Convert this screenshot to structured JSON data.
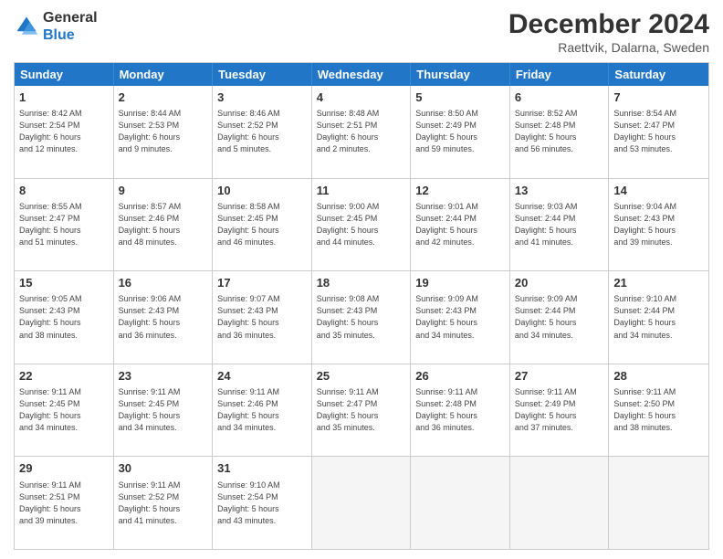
{
  "header": {
    "logo_line1": "General",
    "logo_line2": "Blue",
    "month_title": "December 2024",
    "subtitle": "Raettvik, Dalarna, Sweden"
  },
  "days_of_week": [
    "Sunday",
    "Monday",
    "Tuesday",
    "Wednesday",
    "Thursday",
    "Friday",
    "Saturday"
  ],
  "weeks": [
    [
      {
        "day": "1",
        "lines": [
          "Sunrise: 8:42 AM",
          "Sunset: 2:54 PM",
          "Daylight: 6 hours",
          "and 12 minutes."
        ]
      },
      {
        "day": "2",
        "lines": [
          "Sunrise: 8:44 AM",
          "Sunset: 2:53 PM",
          "Daylight: 6 hours",
          "and 9 minutes."
        ]
      },
      {
        "day": "3",
        "lines": [
          "Sunrise: 8:46 AM",
          "Sunset: 2:52 PM",
          "Daylight: 6 hours",
          "and 5 minutes."
        ]
      },
      {
        "day": "4",
        "lines": [
          "Sunrise: 8:48 AM",
          "Sunset: 2:51 PM",
          "Daylight: 6 hours",
          "and 2 minutes."
        ]
      },
      {
        "day": "5",
        "lines": [
          "Sunrise: 8:50 AM",
          "Sunset: 2:49 PM",
          "Daylight: 5 hours",
          "and 59 minutes."
        ]
      },
      {
        "day": "6",
        "lines": [
          "Sunrise: 8:52 AM",
          "Sunset: 2:48 PM",
          "Daylight: 5 hours",
          "and 56 minutes."
        ]
      },
      {
        "day": "7",
        "lines": [
          "Sunrise: 8:54 AM",
          "Sunset: 2:47 PM",
          "Daylight: 5 hours",
          "and 53 minutes."
        ]
      }
    ],
    [
      {
        "day": "8",
        "lines": [
          "Sunrise: 8:55 AM",
          "Sunset: 2:47 PM",
          "Daylight: 5 hours",
          "and 51 minutes."
        ]
      },
      {
        "day": "9",
        "lines": [
          "Sunrise: 8:57 AM",
          "Sunset: 2:46 PM",
          "Daylight: 5 hours",
          "and 48 minutes."
        ]
      },
      {
        "day": "10",
        "lines": [
          "Sunrise: 8:58 AM",
          "Sunset: 2:45 PM",
          "Daylight: 5 hours",
          "and 46 minutes."
        ]
      },
      {
        "day": "11",
        "lines": [
          "Sunrise: 9:00 AM",
          "Sunset: 2:45 PM",
          "Daylight: 5 hours",
          "and 44 minutes."
        ]
      },
      {
        "day": "12",
        "lines": [
          "Sunrise: 9:01 AM",
          "Sunset: 2:44 PM",
          "Daylight: 5 hours",
          "and 42 minutes."
        ]
      },
      {
        "day": "13",
        "lines": [
          "Sunrise: 9:03 AM",
          "Sunset: 2:44 PM",
          "Daylight: 5 hours",
          "and 41 minutes."
        ]
      },
      {
        "day": "14",
        "lines": [
          "Sunrise: 9:04 AM",
          "Sunset: 2:43 PM",
          "Daylight: 5 hours",
          "and 39 minutes."
        ]
      }
    ],
    [
      {
        "day": "15",
        "lines": [
          "Sunrise: 9:05 AM",
          "Sunset: 2:43 PM",
          "Daylight: 5 hours",
          "and 38 minutes."
        ]
      },
      {
        "day": "16",
        "lines": [
          "Sunrise: 9:06 AM",
          "Sunset: 2:43 PM",
          "Daylight: 5 hours",
          "and 36 minutes."
        ]
      },
      {
        "day": "17",
        "lines": [
          "Sunrise: 9:07 AM",
          "Sunset: 2:43 PM",
          "Daylight: 5 hours",
          "and 36 minutes."
        ]
      },
      {
        "day": "18",
        "lines": [
          "Sunrise: 9:08 AM",
          "Sunset: 2:43 PM",
          "Daylight: 5 hours",
          "and 35 minutes."
        ]
      },
      {
        "day": "19",
        "lines": [
          "Sunrise: 9:09 AM",
          "Sunset: 2:43 PM",
          "Daylight: 5 hours",
          "and 34 minutes."
        ]
      },
      {
        "day": "20",
        "lines": [
          "Sunrise: 9:09 AM",
          "Sunset: 2:44 PM",
          "Daylight: 5 hours",
          "and 34 minutes."
        ]
      },
      {
        "day": "21",
        "lines": [
          "Sunrise: 9:10 AM",
          "Sunset: 2:44 PM",
          "Daylight: 5 hours",
          "and 34 minutes."
        ]
      }
    ],
    [
      {
        "day": "22",
        "lines": [
          "Sunrise: 9:11 AM",
          "Sunset: 2:45 PM",
          "Daylight: 5 hours",
          "and 34 minutes."
        ]
      },
      {
        "day": "23",
        "lines": [
          "Sunrise: 9:11 AM",
          "Sunset: 2:45 PM",
          "Daylight: 5 hours",
          "and 34 minutes."
        ]
      },
      {
        "day": "24",
        "lines": [
          "Sunrise: 9:11 AM",
          "Sunset: 2:46 PM",
          "Daylight: 5 hours",
          "and 34 minutes."
        ]
      },
      {
        "day": "25",
        "lines": [
          "Sunrise: 9:11 AM",
          "Sunset: 2:47 PM",
          "Daylight: 5 hours",
          "and 35 minutes."
        ]
      },
      {
        "day": "26",
        "lines": [
          "Sunrise: 9:11 AM",
          "Sunset: 2:48 PM",
          "Daylight: 5 hours",
          "and 36 minutes."
        ]
      },
      {
        "day": "27",
        "lines": [
          "Sunrise: 9:11 AM",
          "Sunset: 2:49 PM",
          "Daylight: 5 hours",
          "and 37 minutes."
        ]
      },
      {
        "day": "28",
        "lines": [
          "Sunrise: 9:11 AM",
          "Sunset: 2:50 PM",
          "Daylight: 5 hours",
          "and 38 minutes."
        ]
      }
    ],
    [
      {
        "day": "29",
        "lines": [
          "Sunrise: 9:11 AM",
          "Sunset: 2:51 PM",
          "Daylight: 5 hours",
          "and 39 minutes."
        ]
      },
      {
        "day": "30",
        "lines": [
          "Sunrise: 9:11 AM",
          "Sunset: 2:52 PM",
          "Daylight: 5 hours",
          "and 41 minutes."
        ]
      },
      {
        "day": "31",
        "lines": [
          "Sunrise: 9:10 AM",
          "Sunset: 2:54 PM",
          "Daylight: 5 hours",
          "and 43 minutes."
        ]
      },
      {
        "day": "",
        "lines": []
      },
      {
        "day": "",
        "lines": []
      },
      {
        "day": "",
        "lines": []
      },
      {
        "day": "",
        "lines": []
      }
    ]
  ]
}
